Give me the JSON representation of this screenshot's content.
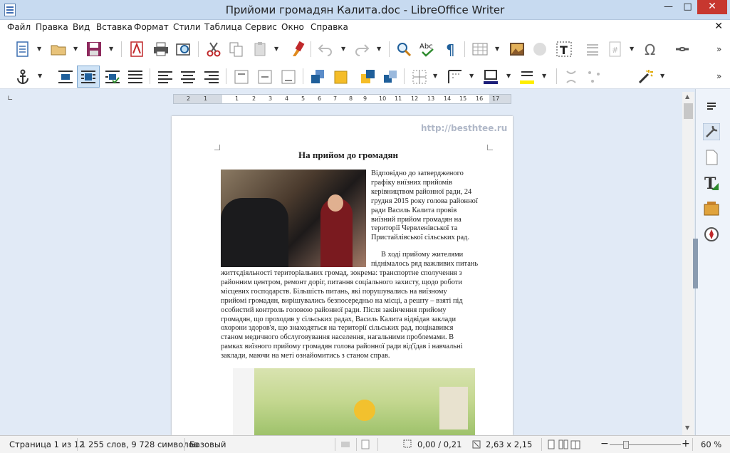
{
  "window": {
    "title": "Прийоми громадян Калита.doc - LibreOffice Writer",
    "minimize": "—",
    "maximize": "□",
    "close": "✕"
  },
  "menu": [
    "Файл",
    "Правка",
    "Вид",
    "Вставка",
    "Формат",
    "Стили",
    "Таблица",
    "Сервис",
    "Окно",
    "Справка"
  ],
  "menu_close": "✕",
  "toolbar1_icons": [
    "new-document-icon",
    "open-folder-icon",
    "save-icon",
    "export-pdf-icon",
    "print-icon",
    "print-preview-icon",
    "cut-icon",
    "copy-icon",
    "paste-icon",
    "clone-formatting-icon",
    "undo-icon",
    "redo-icon",
    "find-replace-icon",
    "spellcheck-icon",
    "formatting-marks-icon",
    "table-icon",
    "image-icon",
    "chart-icon",
    "textbox-icon",
    "page-break-icon",
    "field-icon",
    "special-character-icon",
    "hyperlink-icon"
  ],
  "toolbar2_icons": [
    "anchor-icon",
    "wrap-off-icon",
    "wrap-page-icon",
    "wrap-optimal-icon",
    "wrap-through-icon",
    "align-left-icon",
    "align-center-icon",
    "align-right-icon",
    "align-top-icon",
    "align-middle-icon",
    "align-bottom-icon",
    "bring-front-icon",
    "bring-forward-icon",
    "send-backward-icon",
    "send-back-icon",
    "borders-icon",
    "line-style-icon",
    "border-color-icon",
    "area-color-icon",
    "contour-icon",
    "edit-points-icon",
    "magic-wand-icon"
  ],
  "ruler": {
    "labels": [
      "2",
      "1",
      "1",
      "2",
      "3",
      "4",
      "5",
      "6",
      "7",
      "8",
      "9",
      "10",
      "11",
      "12",
      "13",
      "14",
      "15",
      "16",
      "17"
    ]
  },
  "document": {
    "watermark": "http://besthtee.ru",
    "heading": "На прийом до громадян",
    "para1_lines": [
      "Відповідно до затвердженого",
      "графіку виїзних прийомів",
      "керівництвом районної ради, 24",
      "грудня 2015 року голова районної",
      "ради Василь Калита провів",
      "виїзний прийом громадян на",
      "території Червленівської та",
      "Пристайлівської сільських рад."
    ],
    "para2_lines": [
      "В ході прийому жителями",
      "піднімалось ряд важливих питань",
      "життєдіяльності територіальних громад, зокрема: транспортне сполучення з",
      "районним центром, ремонт доріг, питання соціального захисту, щодо роботи",
      "місцевих господарств. Більшість питань, які порушувались на виїзному",
      "прийомі громадян, вирішувались безпосередньо на місці, а решту – взяті під",
      "особистий контроль головою районної ради. Після закінчення прийому",
      "громадян, що проходив у сільських радах, Василь Калита відвідав заклади",
      "охорони здоров'я, що знаходяться на території сільських рад, поцікавився",
      "станом медичного обслуговування населення, нагальними проблемами. В",
      "рамках виїзного прийому громадян голова районної ради від'їдав і навчальні",
      "заклади, маючи на меті ознайомитись з станом справ."
    ]
  },
  "sidebar_icons": [
    "properties-icon",
    "styles-icon",
    "gallery-icon",
    "navigator-icon",
    "manage-changes-icon",
    "compass-icon"
  ],
  "status": {
    "page": "Страница 1 из 12",
    "words": "1 255 слов, 9 728 символов",
    "style": "Базовый",
    "position": "0,00 / 0,21",
    "size": "2,63 x 2,15",
    "zoom": "60 %"
  }
}
